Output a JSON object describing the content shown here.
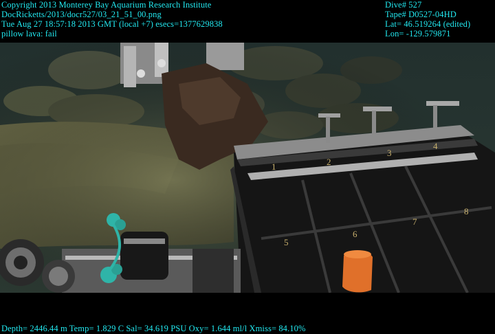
{
  "overlay": {
    "header_left": [
      "Copyright 2013 Monterey Bay Aquarium Research Institute",
      "DocRicketts/2013/docr527/03_21_51_00.png",
      "Tue Aug 27 18:57:18 2013 GMT (local +7)  esecs=1377629838",
      "pillow lava: fail"
    ],
    "header_right": [
      "Dive# 527",
      "Tape# D0527-04HD",
      "Lat= 46.519264 (edited)",
      "Lon= -129.579871"
    ],
    "footer": "Depth= 2446.44 m  Temp= 1.829 C  Sal= 34.619 PSU  Oxy= 1.644 ml/l  Xmiss= 84.10%"
  },
  "scene": {
    "crate_numbers": [
      "1",
      "2",
      "3",
      "4",
      "5",
      "6",
      "7",
      "8"
    ],
    "colors": {
      "water": "#1e2b2a",
      "sediment": "#55553a",
      "pillow_lava": "#3f4535",
      "crate": "#1a1a1a",
      "crate_edge": "#9a9a9a",
      "rock": "#3a2a20",
      "orange_bag": "#e0702a",
      "rope": "#2fb4a8"
    }
  }
}
